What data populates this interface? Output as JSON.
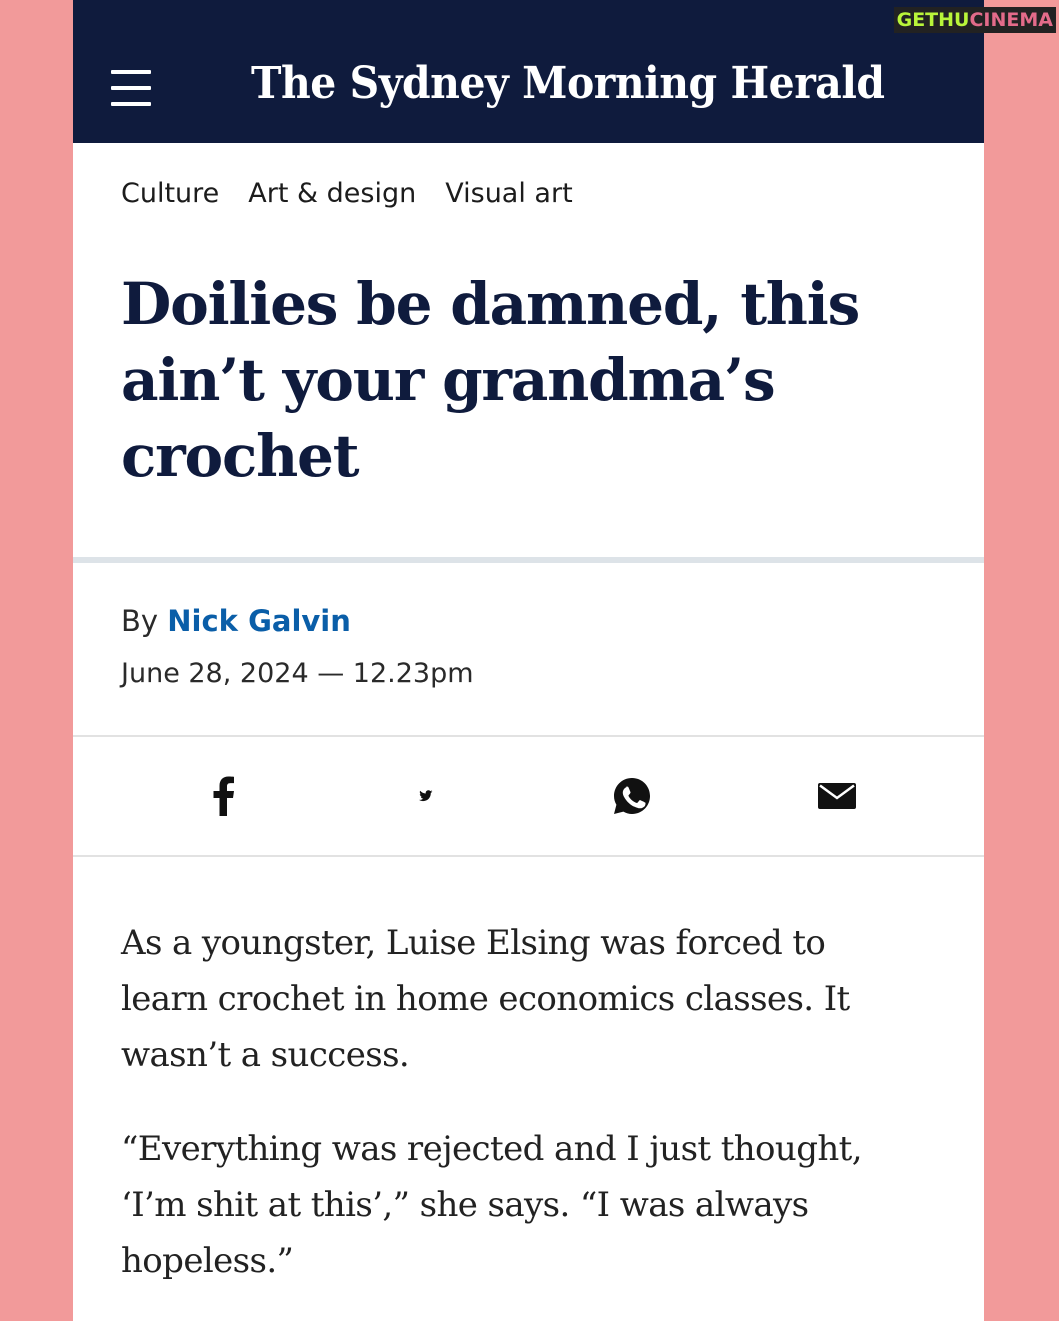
{
  "masthead": {
    "logo": "The Sydney Morning Herald",
    "menu_icon": "hamburger-menu-icon"
  },
  "breadcrumb": [
    "Culture",
    "Art & design",
    "Visual art"
  ],
  "article": {
    "headline": "Doilies be damned, this ain’t your grandma’s crochet",
    "byline_prefix": "By",
    "author": "Nick Galvin",
    "date": "June 28, 2024 — 12.23pm",
    "paragraphs": [
      "As a youngster, Luise Elsing was forced to learn crochet in home economics classes. It wasn’t a success.",
      "“Everything was rejected and I just thought, ‘I’m shit at this’,” she says. “I was always hopeless.”"
    ]
  },
  "share": {
    "icons": [
      "facebook-icon",
      "twitter-icon",
      "whatsapp-icon",
      "email-icon"
    ]
  },
  "watermark": {
    "part1": "GETHU",
    "part2": "CINEMA"
  },
  "colors": {
    "background": "#f29a9a",
    "masthead": "#0f1b3d",
    "author_link": "#0a5ea8"
  }
}
